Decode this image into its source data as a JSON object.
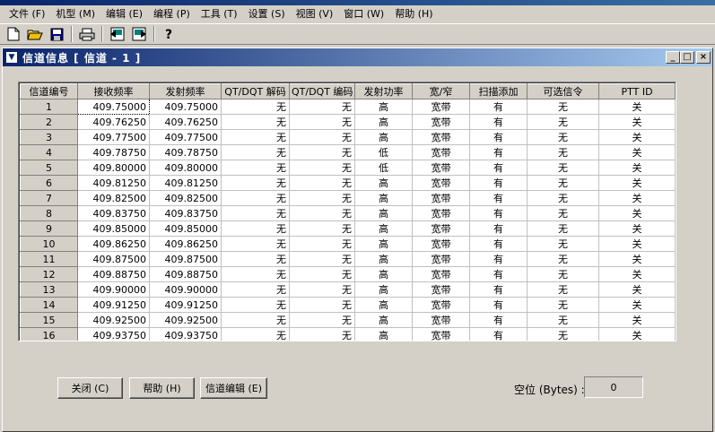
{
  "menu": [
    "文件 (F)",
    "机型 (M)",
    "编辑 (E)",
    "编程 (P)",
    "工具 (T)",
    "设置 (S)",
    "视图 (V)",
    "窗口 (W)",
    "帮助 (H)"
  ],
  "toolbar": {
    "icons": [
      "new-file-icon",
      "open-folder-icon",
      "save-icon",
      "print-icon",
      "read-from-radio-icon",
      "write-to-radio-icon",
      "help-icon"
    ]
  },
  "window": {
    "title": "信道信息 [ 信道 - 1 ]",
    "minimize": "_",
    "maximize": "□",
    "close": "×"
  },
  "grid": {
    "headers": [
      "信道编号",
      "接收频率",
      "发射频率",
      "QT/DQT 解码",
      "QT/DQT 编码",
      "发射功率",
      "宽/窄",
      "扫描添加",
      "可选信令",
      "PTT ID"
    ],
    "rows": [
      [
        "1",
        "409.75000",
        "409.75000",
        "无",
        "无",
        "高",
        "宽带",
        "有",
        "无",
        "关"
      ],
      [
        "2",
        "409.76250",
        "409.76250",
        "无",
        "无",
        "高",
        "宽带",
        "有",
        "无",
        "关"
      ],
      [
        "3",
        "409.77500",
        "409.77500",
        "无",
        "无",
        "高",
        "宽带",
        "有",
        "无",
        "关"
      ],
      [
        "4",
        "409.78750",
        "409.78750",
        "无",
        "无",
        "低",
        "宽带",
        "有",
        "无",
        "关"
      ],
      [
        "5",
        "409.80000",
        "409.80000",
        "无",
        "无",
        "低",
        "宽带",
        "有",
        "无",
        "关"
      ],
      [
        "6",
        "409.81250",
        "409.81250",
        "无",
        "无",
        "高",
        "宽带",
        "有",
        "无",
        "关"
      ],
      [
        "7",
        "409.82500",
        "409.82500",
        "无",
        "无",
        "高",
        "宽带",
        "有",
        "无",
        "关"
      ],
      [
        "8",
        "409.83750",
        "409.83750",
        "无",
        "无",
        "高",
        "宽带",
        "有",
        "无",
        "关"
      ],
      [
        "9",
        "409.85000",
        "409.85000",
        "无",
        "无",
        "高",
        "宽带",
        "有",
        "无",
        "关"
      ],
      [
        "10",
        "409.86250",
        "409.86250",
        "无",
        "无",
        "高",
        "宽带",
        "有",
        "无",
        "关"
      ],
      [
        "11",
        "409.87500",
        "409.87500",
        "无",
        "无",
        "高",
        "宽带",
        "有",
        "无",
        "关"
      ],
      [
        "12",
        "409.88750",
        "409.88750",
        "无",
        "无",
        "高",
        "宽带",
        "有",
        "无",
        "关"
      ],
      [
        "13",
        "409.90000",
        "409.90000",
        "无",
        "无",
        "高",
        "宽带",
        "有",
        "无",
        "关"
      ],
      [
        "14",
        "409.91250",
        "409.91250",
        "无",
        "无",
        "高",
        "宽带",
        "有",
        "无",
        "关"
      ],
      [
        "15",
        "409.92500",
        "409.92500",
        "无",
        "无",
        "高",
        "宽带",
        "有",
        "无",
        "关"
      ],
      [
        "16",
        "409.93750",
        "409.93750",
        "无",
        "无",
        "高",
        "宽带",
        "有",
        "无",
        "关"
      ]
    ]
  },
  "buttons": {
    "close": "关闭 (C)",
    "help": "帮助 (H)",
    "channel_edit": "信道编辑 (E)"
  },
  "free_space": {
    "label": "空位 (Bytes) :",
    "value": "0"
  },
  "colors": {
    "title_bar_start": "#0a246a",
    "title_bar_end": "#a6caf0",
    "face": "#d4d0c8"
  }
}
